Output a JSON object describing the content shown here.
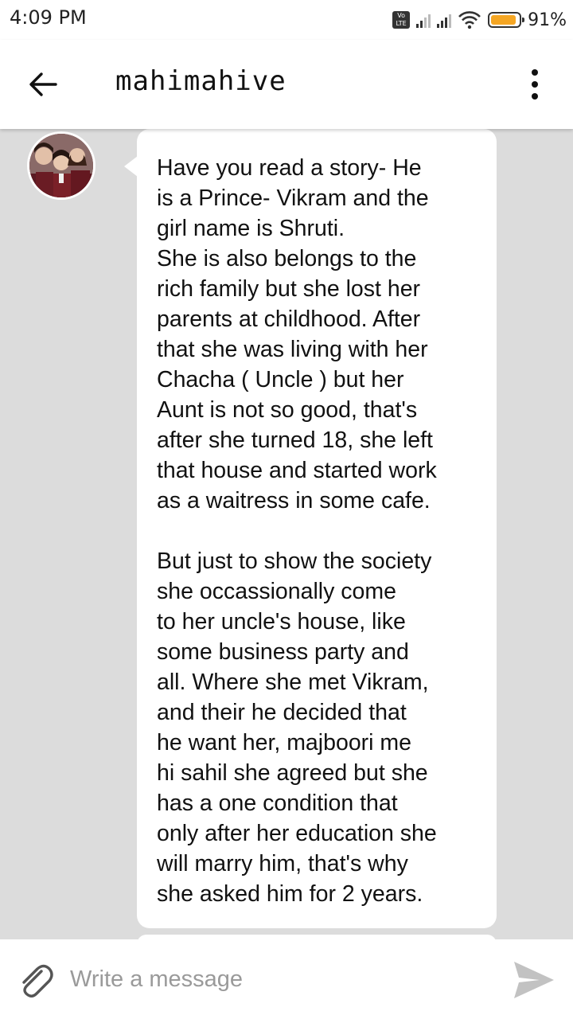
{
  "status_bar": {
    "time": "4:09 PM",
    "volte_top": "Vo",
    "volte_bottom": "LTE",
    "battery": "91%",
    "battery_level": 0.91,
    "battery_color": "#f5a623"
  },
  "header": {
    "back_icon": "arrow-left-icon",
    "title": "mahimahive",
    "menu_icon": "more-vertical-icon"
  },
  "conversation": {
    "avatar_icon": "contact-avatar",
    "message": "Have you read a story- He\nis a Prince- Vikram and the\ngirl name is Shruti.\nShe is also belongs to the\nrich family but she lost her\nparents at childhood. After\nthat she was living with her\nChacha ( Uncle ) but her\nAunt is not so good, that's\nafter she turned 18, she left\nthat house and started work\nas a waitress in some cafe.\n\nBut just to show the society\nshe occassionally come\nto her uncle's house, like\nsome business party and\nall. Where she met Vikram,\nand their he decided that\nhe want her, majboori me\nhi sahil she agreed but she\nhas a one condition that\nonly after her education she\nwill marry him, that's why\nshe asked him for 2 years."
  },
  "composer": {
    "attach_icon": "paperclip-icon",
    "placeholder": "Write a message",
    "value": "",
    "send_icon": "send-icon"
  }
}
